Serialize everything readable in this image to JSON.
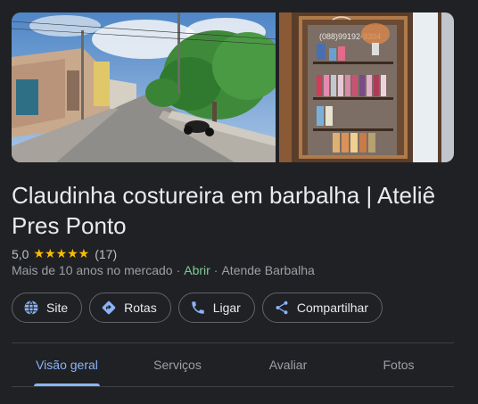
{
  "place": {
    "title": "Claudinha costureira em barbalha | Ateliê Pres Ponto",
    "rating": "5,0",
    "stars": "★★★★★",
    "review_count": "(17)",
    "years": "Mais de 10 anos no mercado",
    "open_status": "Abrir",
    "service_area": "Atende Barbalha",
    "separator": "·"
  },
  "shop_sign_text": "(088)99192-9304",
  "actions": [
    {
      "label": "Site",
      "icon": "globe-icon"
    },
    {
      "label": "Rotas",
      "icon": "directions-icon"
    },
    {
      "label": "Ligar",
      "icon": "phone-icon"
    },
    {
      "label": "Compartilhar",
      "icon": "share-icon"
    }
  ],
  "tabs": [
    {
      "label": "Visão geral",
      "active": true
    },
    {
      "label": "Serviços",
      "active": false
    },
    {
      "label": "Avaliar",
      "active": false
    },
    {
      "label": "Fotos",
      "active": false
    }
  ],
  "colors": {
    "background": "#202124",
    "accent": "#8ab4f8",
    "open": "#81c995",
    "star": "#fbbc04"
  }
}
